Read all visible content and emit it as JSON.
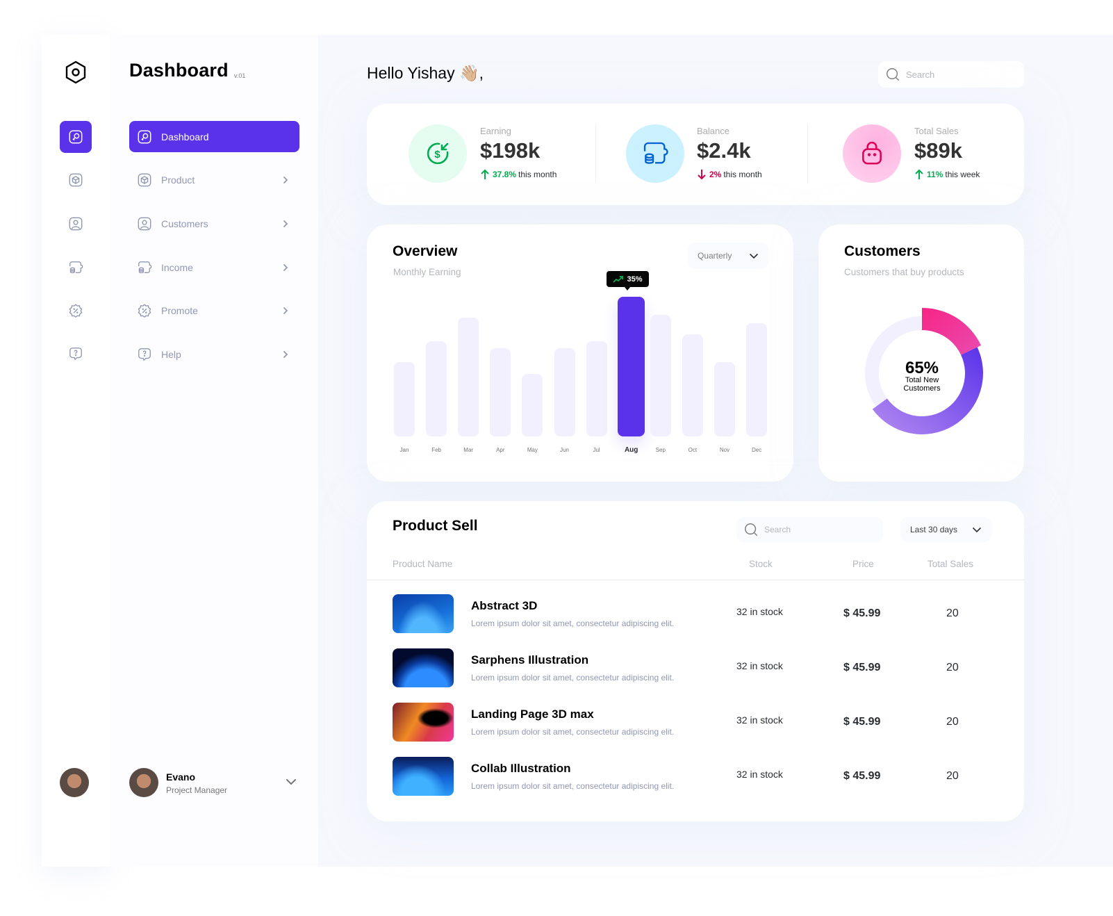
{
  "brand": {
    "title": "Dashboard",
    "version": "v.01"
  },
  "nav": {
    "items": [
      {
        "label": "Dashboard",
        "icon": "key-square-icon",
        "active": true
      },
      {
        "label": "Product",
        "icon": "3d-cube-icon"
      },
      {
        "label": "Customers",
        "icon": "user-square-icon"
      },
      {
        "label": "Income",
        "icon": "wallet-money-icon"
      },
      {
        "label": "Promote",
        "icon": "discount-shape-icon"
      },
      {
        "label": "Help",
        "icon": "message-question-icon"
      }
    ]
  },
  "user": {
    "name": "Evano",
    "role": "Project Manager"
  },
  "header": {
    "greeting": "Hello Yishay",
    "emoji": "👋🏼",
    "suffix": ",",
    "search_placeholder": "Search"
  },
  "stats": [
    {
      "label": "Earning",
      "value": "$198k",
      "change": "37.8%",
      "direction": "up",
      "period": "this month",
      "color": "#00ac4f",
      "bg": "#e5fcf0"
    },
    {
      "label": "Balance",
      "value": "$2.4k",
      "change": "2%",
      "direction": "down",
      "period": "this month",
      "color": "#d0004b",
      "bg": "#cbf1ff"
    },
    {
      "label": "Total Sales",
      "value": "$89k",
      "change": "11%",
      "direction": "up",
      "period": "this week",
      "color": "#00ac4f",
      "bg": "#ffc3ea"
    }
  ],
  "overview": {
    "title": "Overview",
    "subtitle": "Monthly Earning",
    "period_select": "Quarterly",
    "tooltip": "35%"
  },
  "customers": {
    "title": "Customers",
    "subtitle": "Customers that buy products",
    "center_value": "65%",
    "center_label_1": "Total New",
    "center_label_2": "Customers"
  },
  "chart_data": [
    {
      "type": "bar",
      "title": "Overview",
      "subtitle": "Monthly Earning",
      "categories": [
        "Jan",
        "Feb",
        "Mar",
        "Apr",
        "May",
        "Jun",
        "Jul",
        "Aug",
        "Sep",
        "Oct",
        "Nov",
        "Dec"
      ],
      "values": [
        53,
        68,
        85,
        63,
        45,
        63,
        68,
        100,
        87,
        73,
        53,
        81
      ],
      "highlight": "Aug",
      "highlight_annotation": "35%",
      "xlabel": "",
      "ylabel": "",
      "ylim": [
        0,
        100
      ],
      "grid": false,
      "colors": {
        "bar": "#f2efff",
        "highlight": "#5932ea"
      }
    },
    {
      "type": "pie",
      "title": "Customers",
      "subtitle": "Customers that buy products",
      "donut": true,
      "center_text": "65% Total New Customers",
      "slices": [
        {
          "name": "segment-pink",
          "value": 18,
          "color": "#f72585"
        },
        {
          "name": "segment-purple",
          "value": 47,
          "color": "#5932ea"
        },
        {
          "name": "remaining",
          "value": 35,
          "color": "#f2efff"
        }
      ]
    }
  ],
  "product_sell": {
    "title": "Product Sell",
    "search_placeholder": "Search",
    "range_select": "Last 30 days",
    "columns": [
      "Product Name",
      "Stock",
      "Price",
      "Total Sales"
    ],
    "rows": [
      {
        "name": "Abstract 3D",
        "desc": "Lorem ipsum dolor sit amet, consectetur adipiscing elit.",
        "stock": "32 in stock",
        "price": "$ 45.99",
        "sales": "20",
        "thumb": "abstract-3d-thumbnail"
      },
      {
        "name": "Sarphens Illustration",
        "desc": "Lorem ipsum dolor sit amet, consectetur adipiscing elit.",
        "stock": "32 in stock",
        "price": "$ 45.99",
        "sales": "20",
        "thumb": "sarphens-thumbnail"
      },
      {
        "name": "Landing Page 3D max",
        "desc": "Lorem ipsum dolor sit amet, consectetur adipiscing elit.",
        "stock": "32 in stock",
        "price": "$ 45.99",
        "sales": "20",
        "thumb": "landing-page-thumbnail"
      },
      {
        "name": "Collab Illustration",
        "desc": "Lorem ipsum dolor sit amet, consectetur adipiscing elit.",
        "stock": "32 in stock",
        "price": "$ 45.99",
        "sales": "20",
        "thumb": "collab-thumbnail"
      }
    ]
  }
}
